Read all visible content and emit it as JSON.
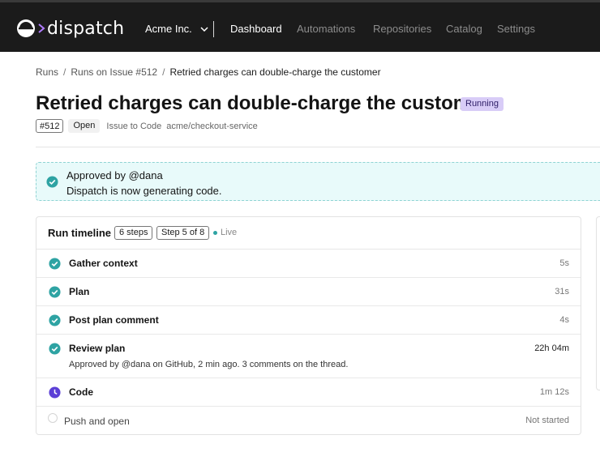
{
  "brand": {
    "name": "dispatch"
  },
  "org": {
    "name": "Acme Inc."
  },
  "nav": {
    "items": [
      {
        "label": "Dashboard",
        "active": true
      },
      {
        "label": "Automations",
        "active": false
      },
      {
        "label": "Repositories",
        "active": false
      },
      {
        "label": "Catalog",
        "active": false
      },
      {
        "label": "Settings",
        "active": false
      }
    ]
  },
  "breadcrumb": {
    "items": [
      "Runs",
      "Runs on Issue #512"
    ],
    "current": "Retried charges can double-charge the customer",
    "separator": "/"
  },
  "page": {
    "title": "Retried charges can double-charge the customer",
    "status": "Running"
  },
  "meta": {
    "issue_number": "#512",
    "state": "Open",
    "automation": "Issue to Code",
    "repo": "acme/checkout-service"
  },
  "banner": {
    "title": "Approved by @dana",
    "subtitle": "Dispatch is now generating code."
  },
  "timeline": {
    "title": "Run timeline",
    "steps_count": "6 steps",
    "progress": "Step 5 of 8",
    "live_label": "Live",
    "steps": [
      {
        "name": "Gather context",
        "duration": "5s",
        "status": "done",
        "detail": ""
      },
      {
        "name": "Plan",
        "duration": "31s",
        "status": "done",
        "detail": ""
      },
      {
        "name": "Post plan comment",
        "duration": "4s",
        "status": "done",
        "detail": ""
      },
      {
        "name": "Review plan",
        "duration": "22h 04m",
        "status": "done",
        "detail": "Approved by @dana on GitHub, 2 min ago. 3 comments on the thread."
      },
      {
        "name": "Code",
        "duration": "1m 12s",
        "status": "in-progress",
        "detail": ""
      },
      {
        "name": "Push and open",
        "duration": "Not started",
        "status": "pending",
        "detail": ""
      }
    ]
  },
  "colors": {
    "nav_bg": "#1b1b1b",
    "accent_teal": "#2ea3a3",
    "in_progress": "#5b3fd6",
    "running_pill": "#d8ccf7",
    "banner_bg": "#e8fafa"
  }
}
